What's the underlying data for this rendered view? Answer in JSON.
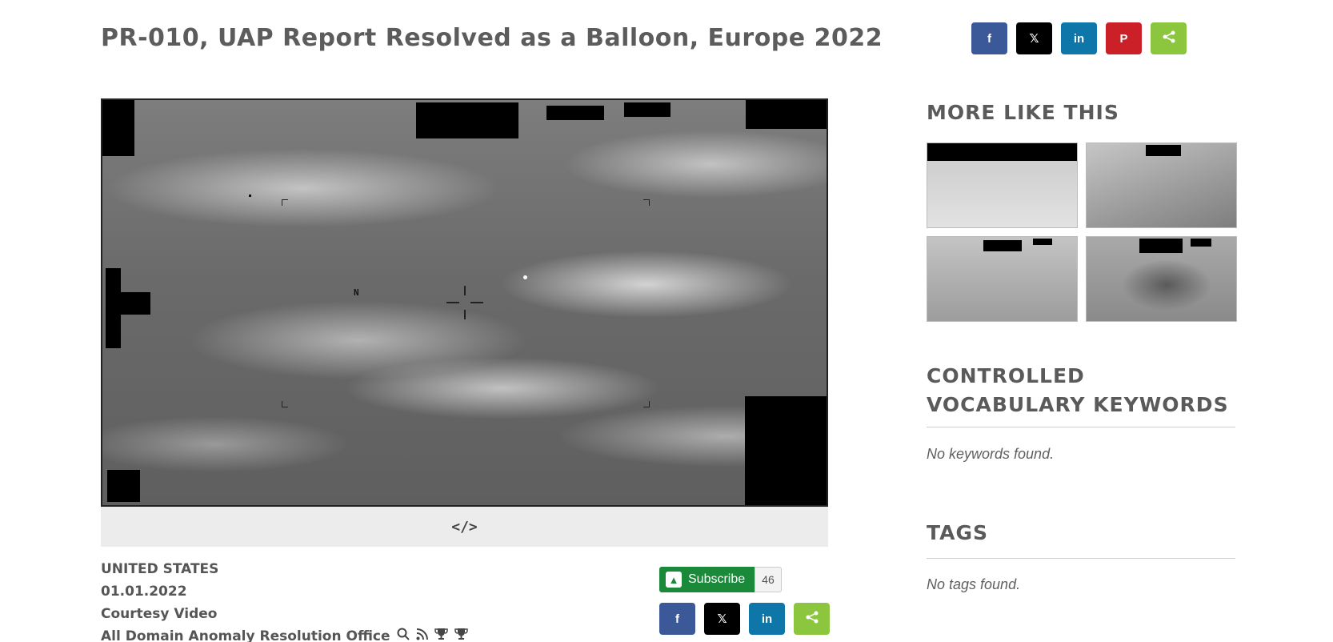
{
  "page": {
    "title": "PR-010, UAP Report Resolved as a Balloon, Europe 2022"
  },
  "share_top": [
    {
      "name": "facebook",
      "glyph": "f",
      "icon": "facebook-icon"
    },
    {
      "name": "x",
      "glyph": "𝕏",
      "icon": "x-icon"
    },
    {
      "name": "linkedin",
      "glyph": "in",
      "icon": "linkedin-icon"
    },
    {
      "name": "pinterest",
      "glyph": "P",
      "icon": "pinterest-icon"
    },
    {
      "name": "share",
      "glyph": "<",
      "icon": "share-icon"
    }
  ],
  "video": {
    "hud_letter": "N",
    "embed_glyph": "</>"
  },
  "meta": {
    "country": "UNITED STATES",
    "date": "01.01.2022",
    "type": "Courtesy Video",
    "unit": "All Domain Anomaly Resolution Office"
  },
  "subscribe": {
    "label": "Subscribe",
    "count": "46"
  },
  "sidebar": {
    "more_heading": "MORE LIKE THIS",
    "vocab_heading": "CONTROLLED VOCABULARY KEYWORDS",
    "vocab_empty": "No keywords found.",
    "tags_heading": "TAGS",
    "tags_empty": "No tags found."
  }
}
